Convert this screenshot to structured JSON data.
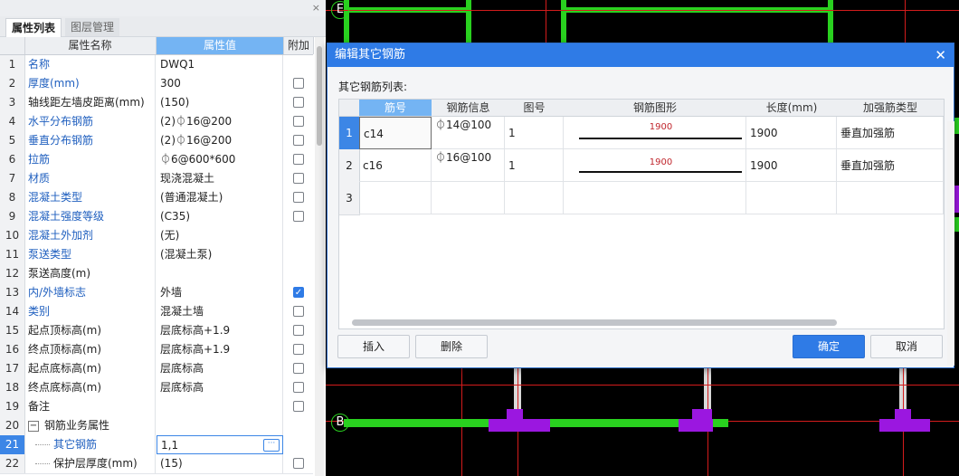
{
  "left_panel": {
    "close_glyph": "×",
    "tabs": [
      "属性列表",
      "图层管理"
    ],
    "headers": {
      "name": "属性名称",
      "value": "属性值",
      "extra": "附加"
    },
    "rows": [
      {
        "num": "1",
        "name": "名称",
        "value": "DWQ1",
        "blue": true,
        "checkbox": "none"
      },
      {
        "num": "2",
        "name": "厚度(mm)",
        "value": "300",
        "blue": true,
        "checkbox": "off"
      },
      {
        "num": "3",
        "name": "轴线距左墙皮距离(mm)",
        "value": "(150)",
        "blue": false,
        "checkbox": "off"
      },
      {
        "num": "4",
        "name": "水平分布钢筋",
        "value": "(2)⏀16@200",
        "blue": true,
        "checkbox": "off"
      },
      {
        "num": "5",
        "name": "垂直分布钢筋",
        "value": "(2)⏀16@200",
        "blue": true,
        "checkbox": "off"
      },
      {
        "num": "6",
        "name": "拉筋",
        "value": "⏀6@600*600",
        "blue": true,
        "checkbox": "off"
      },
      {
        "num": "7",
        "name": "材质",
        "value": "现浇混凝土",
        "blue": true,
        "checkbox": "off"
      },
      {
        "num": "8",
        "name": "混凝土类型",
        "value": "(普通混凝土)",
        "blue": true,
        "checkbox": "off"
      },
      {
        "num": "9",
        "name": "混凝土强度等级",
        "value": "(C35)",
        "blue": true,
        "checkbox": "off"
      },
      {
        "num": "10",
        "name": "混凝土外加剂",
        "value": "(无)",
        "blue": true,
        "checkbox": "none"
      },
      {
        "num": "11",
        "name": "泵送类型",
        "value": "(混凝土泵)",
        "blue": true,
        "checkbox": "none"
      },
      {
        "num": "12",
        "name": "泵送高度(m)",
        "value": "",
        "blue": false,
        "checkbox": "none"
      },
      {
        "num": "13",
        "name": "内/外墙标志",
        "value": "外墙",
        "blue": true,
        "checkbox": "on"
      },
      {
        "num": "14",
        "name": "类别",
        "value": "混凝土墙",
        "blue": true,
        "checkbox": "off"
      },
      {
        "num": "15",
        "name": "起点顶标高(m)",
        "value": "层底标高+1.9",
        "blue": false,
        "checkbox": "off"
      },
      {
        "num": "16",
        "name": "终点顶标高(m)",
        "value": "层底标高+1.9",
        "blue": false,
        "checkbox": "off"
      },
      {
        "num": "17",
        "name": "起点底标高(m)",
        "value": "层底标高",
        "blue": false,
        "checkbox": "off"
      },
      {
        "num": "18",
        "name": "终点底标高(m)",
        "value": "层底标高",
        "blue": false,
        "checkbox": "off"
      },
      {
        "num": "19",
        "name": "备注",
        "value": "",
        "blue": false,
        "checkbox": "off"
      },
      {
        "num": "20",
        "name": "钢筋业务属性",
        "value": "",
        "blue": false,
        "checkbox": "none",
        "group": true,
        "expander": "−"
      },
      {
        "num": "21",
        "name": "其它钢筋",
        "value": "1,1",
        "blue": true,
        "checkbox": "none",
        "indent": true,
        "selected": true,
        "ellipsis": "···"
      },
      {
        "num": "22",
        "name": "保护层厚度(mm)",
        "value": "(15)",
        "blue": false,
        "checkbox": "off",
        "indent": true
      }
    ]
  },
  "cad": {
    "axis_labels": [
      "E",
      "B"
    ]
  },
  "dialog": {
    "title": "编辑其它钢筋",
    "close_glyph": "✕",
    "list_label": "其它钢筋列表:",
    "columns": [
      "筋号",
      "钢筋信息",
      "图号",
      "钢筋图形",
      "长度(mm)",
      "加强筋类型"
    ],
    "rows": [
      {
        "num": "1",
        "bar_no": "c14",
        "info": "⏀14@100",
        "fig_no": "1",
        "shape_value": "1900",
        "length": "1900",
        "type": "垂直加强筋"
      },
      {
        "num": "2",
        "bar_no": "c16",
        "info": "⏀16@100",
        "fig_no": "1",
        "shape_value": "1900",
        "length": "1900",
        "type": "垂直加强筋"
      },
      {
        "num": "3",
        "bar_no": "",
        "info": "",
        "fig_no": "",
        "shape_value": "",
        "length": "",
        "type": ""
      }
    ],
    "buttons": {
      "insert": "插入",
      "delete": "删除",
      "ok": "确定",
      "cancel": "取消"
    }
  }
}
